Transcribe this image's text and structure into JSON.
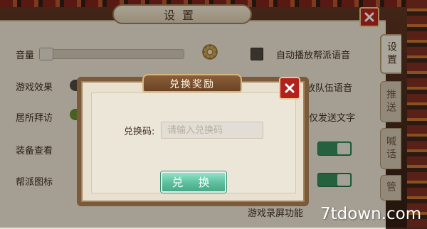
{
  "settings": {
    "title": "设置",
    "tabs": [
      "设置",
      "推送",
      "喊话",
      "管"
    ],
    "rows": {
      "volume": "音量",
      "game_effects": "游戏效果",
      "home_visit": "居所拜访",
      "equipment_view": "装备查看",
      "guild_icon": "帮派图标"
    },
    "right_options": {
      "auto_guild_voice": "自动播放帮派语音",
      "team_voice": "放队伍语音",
      "text_only": "仅发送文字"
    },
    "footer_partial": "游戏录屏功能"
  },
  "dialog": {
    "title": "兑换奖励",
    "code_label": "兑换码:",
    "code_placeholder": "请输入兑换码",
    "code_value": "",
    "redeem_label": "兑 换"
  },
  "watermark": "7tdown.com",
  "colors": {
    "close_red": "#b3211c",
    "toggle_green": "#2e8a56",
    "redeem_green": "#5cbf9e"
  },
  "icons": [
    "gear-icon",
    "close-icon"
  ]
}
